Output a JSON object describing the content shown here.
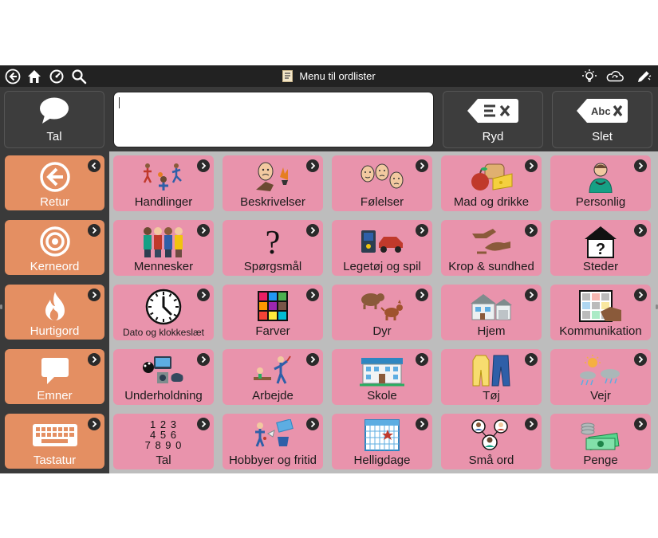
{
  "titlebar": {
    "title": "Menu til ordlister"
  },
  "message": {
    "speak_label": "Tal",
    "clear_label": "Ryd",
    "delete_label": "Slet",
    "clear_icon_text": "",
    "delete_icon_text": "Abc"
  },
  "nav": [
    {
      "label": "Retur"
    },
    {
      "label": "Kerneord"
    },
    {
      "label": "Hurtigord"
    },
    {
      "label": "Emner"
    },
    {
      "label": "Tastatur"
    }
  ],
  "grid": [
    {
      "label": "Handlinger"
    },
    {
      "label": "Beskrivelser"
    },
    {
      "label": "Følelser"
    },
    {
      "label": "Mad og drikke"
    },
    {
      "label": "Personlig"
    },
    {
      "label": "Mennesker"
    },
    {
      "label": "Spørgsmål"
    },
    {
      "label": "Legetøj og spil"
    },
    {
      "label": "Krop & sundhed"
    },
    {
      "label": "Steder"
    },
    {
      "label": "Dato og klokkeslæt"
    },
    {
      "label": "Farver"
    },
    {
      "label": "Dyr"
    },
    {
      "label": "Hjem"
    },
    {
      "label": "Kommunikation"
    },
    {
      "label": "Underholdning"
    },
    {
      "label": "Arbejde"
    },
    {
      "label": "Skole"
    },
    {
      "label": "Tøj"
    },
    {
      "label": "Vejr"
    },
    {
      "label": "Tal"
    },
    {
      "label": "Hobbyer og fritid"
    },
    {
      "label": "Helligdage"
    },
    {
      "label": "Små ord"
    },
    {
      "label": "Penge"
    }
  ],
  "symbols": {
    "question_mark": "?",
    "numbers": [
      "1 2 3",
      "4 5 6",
      "7 8 9 0"
    ]
  },
  "colors": {
    "nav_orange": "#e48f62",
    "cell_pink": "#e993ac",
    "grid_bg": "#bdbdbd",
    "dark": "#3a3a3a"
  }
}
